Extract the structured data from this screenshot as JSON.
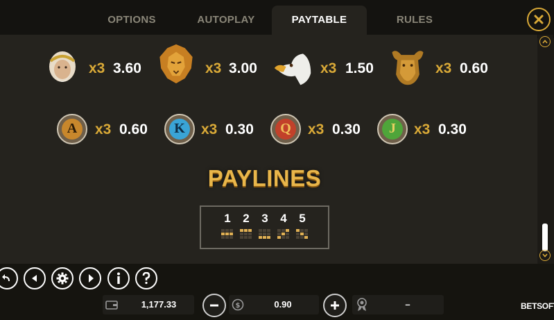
{
  "tabs": {
    "options": "OPTIONS",
    "autoplay": "AUTOPLAY",
    "paytable": "PAYTABLE",
    "rules": "RULES",
    "active": "paytable"
  },
  "paytable": {
    "high_symbols": [
      {
        "name": "zeus",
        "icon": "zeus-symbol-icon",
        "multiplier": "x3",
        "value": "3.60"
      },
      {
        "name": "lion",
        "icon": "lion-symbol-icon",
        "multiplier": "x3",
        "value": "3.00"
      },
      {
        "name": "eagle",
        "icon": "eagle-symbol-icon",
        "multiplier": "x3",
        "value": "1.50"
      },
      {
        "name": "bull",
        "icon": "bull-symbol-icon",
        "multiplier": "x3",
        "value": "0.60"
      }
    ],
    "low_symbols": [
      {
        "letter": "A",
        "color": "#c8872c",
        "multiplier": "x3",
        "value": "0.60"
      },
      {
        "letter": "K",
        "color": "#3aa4d6",
        "multiplier": "x3",
        "value": "0.30"
      },
      {
        "letter": "Q",
        "color": "#c2412a",
        "multiplier": "x3",
        "value": "0.30"
      },
      {
        "letter": "J",
        "color": "#4fa53a",
        "multiplier": "x3",
        "value": "0.30"
      }
    ]
  },
  "paylines": {
    "title": "PAYLINES",
    "lines": [
      "1",
      "2",
      "3",
      "4",
      "5"
    ]
  },
  "bottom_bar": {
    "balance": "1,177.33",
    "bet": "0.90",
    "win": "–",
    "brand": "BETSOFT"
  },
  "colors": {
    "accent": "#d9a937",
    "background": "#25231e"
  }
}
